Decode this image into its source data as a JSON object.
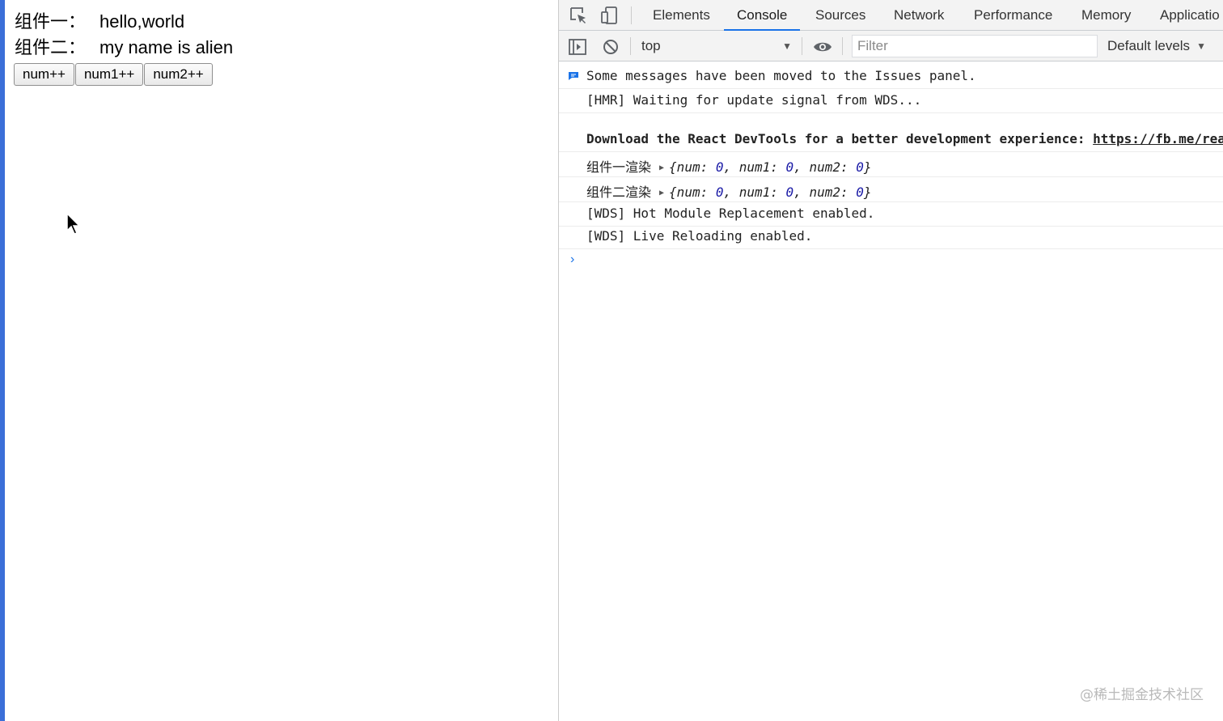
{
  "app": {
    "component1_label": "组件一：",
    "component1_value": "hello,world",
    "component2_label": "组件二：",
    "component2_value": "my name is alien",
    "buttons": [
      {
        "label": "num++"
      },
      {
        "label": "num1++"
      },
      {
        "label": "num2++"
      }
    ]
  },
  "devtools": {
    "tabs": [
      {
        "label": "Elements"
      },
      {
        "label": "Console"
      },
      {
        "label": "Sources"
      },
      {
        "label": "Network"
      },
      {
        "label": "Performance"
      },
      {
        "label": "Memory"
      },
      {
        "label": "Applicatio"
      }
    ],
    "active_tab": "Console",
    "toolbar": {
      "context": "top",
      "filter_placeholder": "Filter",
      "levels": "Default levels"
    },
    "console": {
      "issues_message": "Some messages have been moved to the Issues panel.",
      "hmr_message": "[HMR] Waiting for update signal from WDS...",
      "react_message_text": "Download the React DevTools for a better development experience: ",
      "react_message_link": "https://fb.me/react-devtools",
      "log1_label": "组件一渲染",
      "log2_label": "组件二渲染",
      "obj": {
        "num": "0",
        "num1": "0",
        "num2": "0"
      },
      "wds1_message": "[WDS] Hot Module Replacement enabled.",
      "wds2_message": "[WDS] Live Reloading enabled."
    }
  },
  "watermark": "@稀土掘金技术社区",
  "colors": {
    "accent": "#1a73e8",
    "number": "#1a1aa6",
    "left_strip": "#3b6fd8"
  }
}
